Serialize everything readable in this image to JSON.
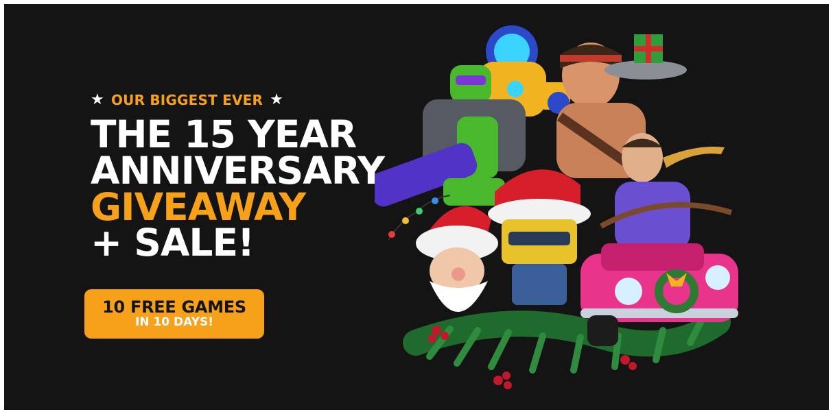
{
  "promo": {
    "kicker_text": "OUR BIGGEST EVER",
    "headline": {
      "line1": "THE 15 YEAR",
      "line2": "ANNIVERSARY",
      "line3": "GIVEAWAY",
      "line4": "+ SALE!"
    },
    "cta": {
      "line1": "10 FREE GAMES",
      "line2": "IN 10 DAYS!"
    }
  },
  "colors": {
    "background": "#141414",
    "accent": "#f7a11a",
    "text": "#ffffff"
  },
  "icons": {
    "kicker_left": "star-icon",
    "kicker_right": "star-icon"
  }
}
